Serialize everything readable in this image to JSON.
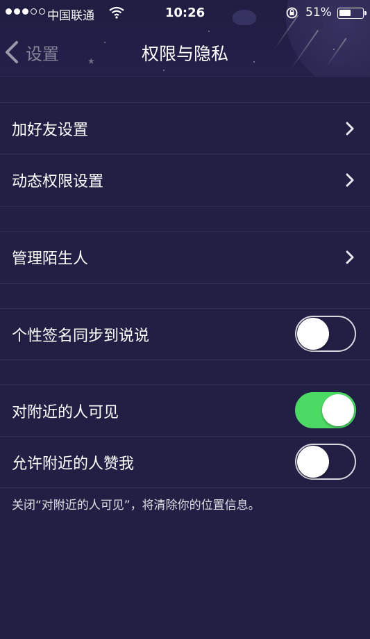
{
  "status_bar": {
    "carrier": "中国联通",
    "time": "10:26",
    "battery_percent": "51%",
    "battery_level": 0.51,
    "signal_strength": 3
  },
  "nav": {
    "back_label": "设置",
    "title": "权限与隐私"
  },
  "groups": {
    "friends": [
      {
        "label": "加好友设置",
        "control": "chevron"
      },
      {
        "label": "动态权限设置",
        "control": "chevron"
      }
    ],
    "strangers": [
      {
        "label": "管理陌生人",
        "control": "chevron"
      }
    ],
    "signature": [
      {
        "label": "个性签名同步到说说",
        "control": "switch",
        "on": false
      }
    ],
    "nearby": [
      {
        "label": "对附近的人可见",
        "control": "switch",
        "on": true
      },
      {
        "label": "允许附近的人赞我",
        "control": "switch",
        "on": false
      }
    ]
  },
  "footnote": "关闭“对附近的人可见”，将清除你的位置信息。",
  "colors": {
    "background": "#221f45",
    "switch_on": "#4cd964",
    "separator": "#34305c"
  }
}
